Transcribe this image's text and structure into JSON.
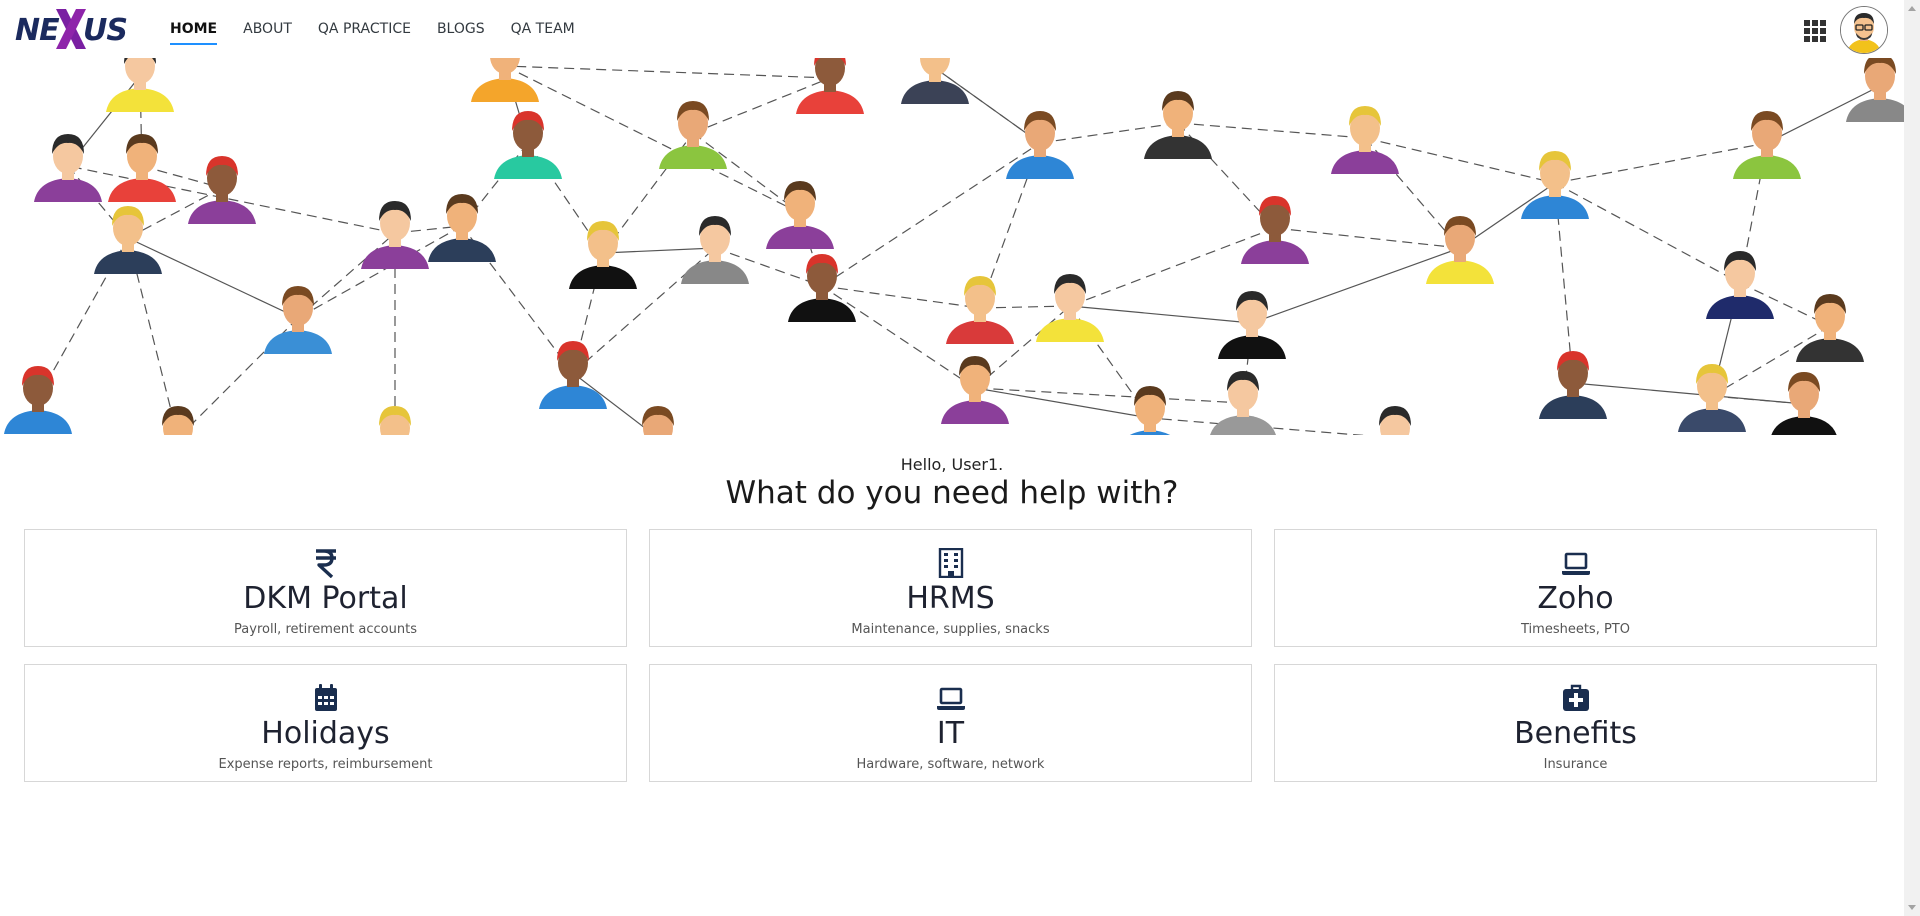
{
  "app": {
    "logo_left": "NE",
    "logo_right": "US",
    "brand_color": "#1b2a5e",
    "brand_x_color": "#7a1fa2"
  },
  "nav": {
    "items": [
      {
        "label": "HOME",
        "active": true
      },
      {
        "label": "ABOUT",
        "active": false
      },
      {
        "label": "QA PRACTICE",
        "active": false
      },
      {
        "label": "BLOGS",
        "active": false
      },
      {
        "label": "QA TEAM",
        "active": false
      }
    ],
    "active_underline_color": "#1e90ff",
    "apps_icon": "grid-icon",
    "profile_icon": "user-avatar"
  },
  "hero": {
    "image": "people-network-illustration"
  },
  "main": {
    "greeting": "Hello, User1.",
    "question": "What do you need help with?"
  },
  "cards": [
    {
      "icon": "rupee-icon",
      "title": "DKM Portal",
      "subtitle": "Payroll, retirement accounts"
    },
    {
      "icon": "building-icon",
      "title": "HRMS",
      "subtitle": "Maintenance, supplies, snacks"
    },
    {
      "icon": "laptop-icon",
      "title": "Zoho",
      "subtitle": "Timesheets, PTO"
    },
    {
      "icon": "calendar-icon",
      "title": "Holidays",
      "subtitle": "Expense reports, reimbursement"
    },
    {
      "icon": "laptop-icon",
      "title": "IT",
      "subtitle": "Hardware, software, network"
    },
    {
      "icon": "medical-kit-icon",
      "title": "Benefits",
      "subtitle": "Insurance"
    }
  ],
  "icon_color": "#1a2e4f"
}
